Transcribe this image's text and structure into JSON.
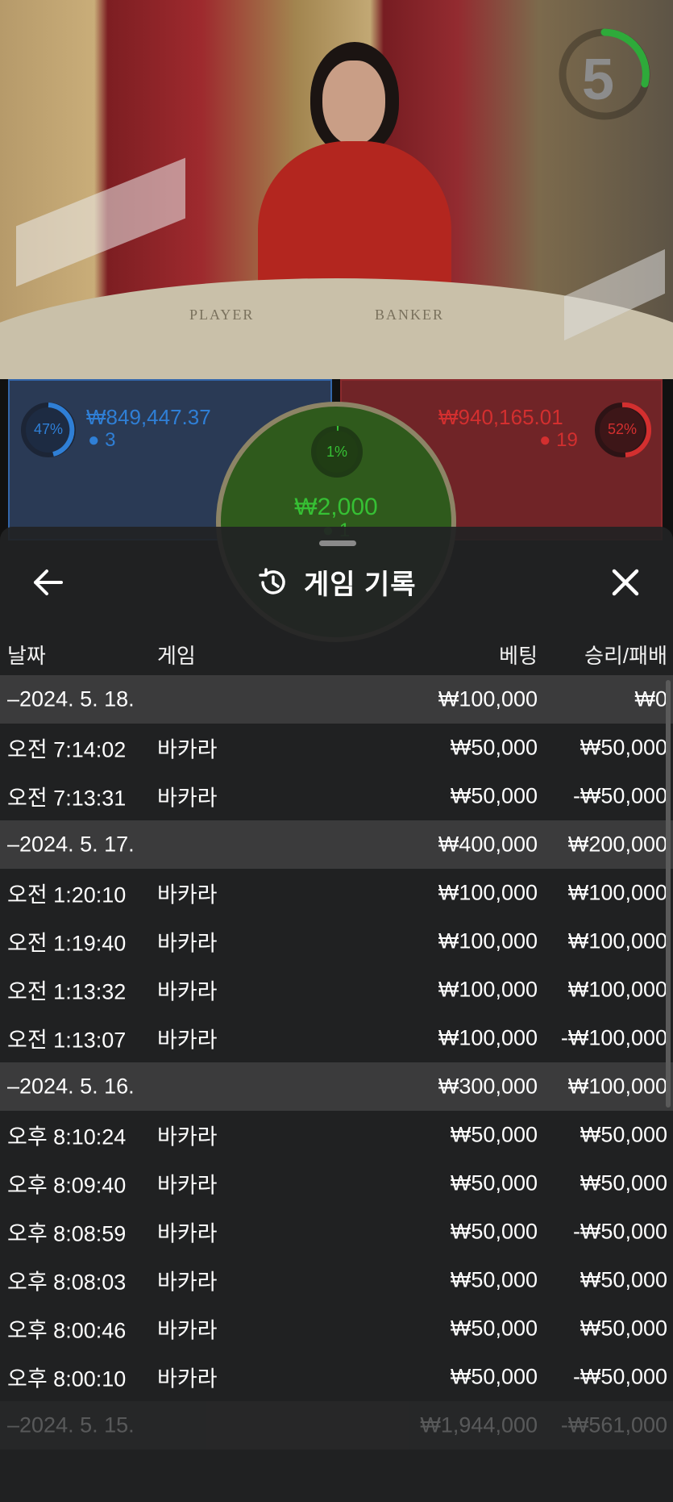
{
  "countdown": {
    "value": "5",
    "ring_color": "#2eaa3a",
    "fraction_remaining": 0.22
  },
  "table_labels": {
    "player": "PLAYER",
    "banker": "BANKER"
  },
  "bets": {
    "player": {
      "percent": "47%",
      "amount": "₩849,447.37",
      "players": "3",
      "color": "#2f7fd6"
    },
    "banker": {
      "percent": "52%",
      "amount": "₩940,165.01",
      "players": "19",
      "color": "#d32f2f"
    },
    "tie": {
      "percent": "1%",
      "amount": "₩2,000",
      "players": "1",
      "color": "#36c034"
    }
  },
  "history": {
    "title": "게임 기록",
    "icons": {
      "back": "arrow-left-icon",
      "title": "history-icon",
      "close": "close-icon"
    },
    "columns": {
      "date": "날짜",
      "game": "게임",
      "bet": "베팅",
      "result": "승리/패배"
    },
    "rows": [
      {
        "type": "date",
        "label": "–2024. 5. 18.",
        "bet": "₩100,000",
        "result": "₩0"
      },
      {
        "type": "game",
        "time": "오전 7:14:02",
        "game": "바카라",
        "bet": "₩50,000",
        "result": "₩50,000"
      },
      {
        "type": "game",
        "time": "오전 7:13:31",
        "game": "바카라",
        "bet": "₩50,000",
        "result": "-₩50,000"
      },
      {
        "type": "date",
        "label": "–2024. 5. 17.",
        "bet": "₩400,000",
        "result": "₩200,000"
      },
      {
        "type": "game",
        "time": "오전 1:20:10",
        "game": "바카라",
        "bet": "₩100,000",
        "result": "₩100,000"
      },
      {
        "type": "game",
        "time": "오전 1:19:40",
        "game": "바카라",
        "bet": "₩100,000",
        "result": "₩100,000"
      },
      {
        "type": "game",
        "time": "오전 1:13:32",
        "game": "바카라",
        "bet": "₩100,000",
        "result": "₩100,000"
      },
      {
        "type": "game",
        "time": "오전 1:13:07",
        "game": "바카라",
        "bet": "₩100,000",
        "result": "-₩100,000"
      },
      {
        "type": "date",
        "label": "–2024. 5. 16.",
        "bet": "₩300,000",
        "result": "₩100,000"
      },
      {
        "type": "game",
        "time": "오후 8:10:24",
        "game": "바카라",
        "bet": "₩50,000",
        "result": "₩50,000"
      },
      {
        "type": "game",
        "time": "오후 8:09:40",
        "game": "바카라",
        "bet": "₩50,000",
        "result": "₩50,000"
      },
      {
        "type": "game",
        "time": "오후 8:08:59",
        "game": "바카라",
        "bet": "₩50,000",
        "result": "-₩50,000"
      },
      {
        "type": "game",
        "time": "오후 8:08:03",
        "game": "바카라",
        "bet": "₩50,000",
        "result": "₩50,000"
      },
      {
        "type": "game",
        "time": "오후 8:00:46",
        "game": "바카라",
        "bet": "₩50,000",
        "result": "₩50,000"
      },
      {
        "type": "game",
        "time": "오후 8:00:10",
        "game": "바카라",
        "bet": "₩50,000",
        "result": "-₩50,000"
      },
      {
        "type": "date",
        "label": "–2024. 5. 15.",
        "bet": "₩1,944,000",
        "result": "-₩561,000",
        "faded": true
      }
    ]
  }
}
